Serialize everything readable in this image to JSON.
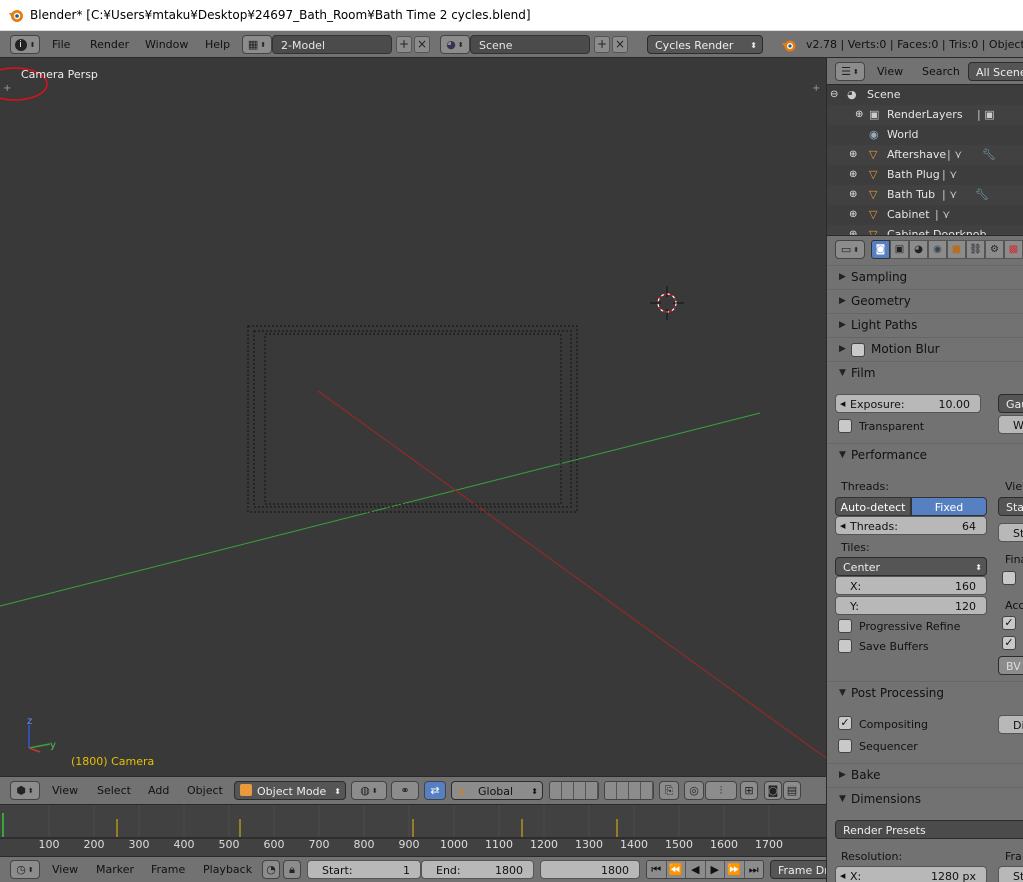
{
  "window_title": "Blender* [C:¥Users¥mtaku¥Desktop¥24697_Bath_Room¥Bath Time 2 cycles.blend]",
  "info_header": {
    "menus": [
      "File",
      "Render",
      "Window",
      "Help"
    ],
    "screen_layout": "2-Model",
    "scene": "Scene",
    "render_engine": "Cycles Render",
    "stats": "v2.78 | Verts:0 | Faces:0 | Tris:0 | Objects:0/"
  },
  "viewport": {
    "view_label": "Camera Persp",
    "object_label": "(1800) Camera"
  },
  "viewport_header": {
    "menus": [
      "View",
      "Select",
      "Add",
      "Object"
    ],
    "mode": "Object Mode",
    "orientation": "Global"
  },
  "timeline": {
    "ticks": [
      "100",
      "200",
      "300",
      "400",
      "500",
      "600",
      "700",
      "800",
      "900",
      "1000",
      "1100",
      "1200",
      "1300",
      "1400",
      "1500",
      "1600",
      "1700"
    ],
    "menus": [
      "View",
      "Marker",
      "Frame",
      "Playback"
    ],
    "start_label": "Start:",
    "start_value": "1",
    "end_label": "End:",
    "end_value": "1800",
    "current_frame": "1800",
    "frame_dropped": "Frame Dr"
  },
  "outliner": {
    "header_menus": [
      "View",
      "Search"
    ],
    "display_mode": "All Scene",
    "items": [
      {
        "label": "Scene"
      },
      {
        "label": "RenderLayers"
      },
      {
        "label": "World"
      },
      {
        "label": "Aftershave"
      },
      {
        "label": "Bath Plug"
      },
      {
        "label": "Bath Tub"
      },
      {
        "label": "Cabinet"
      },
      {
        "label": "Cabinet Doorknob"
      }
    ]
  },
  "properties": {
    "panels": {
      "sampling": "Sampling",
      "geometry": "Geometry",
      "light_paths": "Light Paths",
      "motion_blur": "Motion Blur",
      "film": "Film",
      "performance": "Performance",
      "post_processing": "Post Processing",
      "bake": "Bake",
      "dimensions": "Dimensions"
    },
    "film": {
      "exposure_label": "Exposure:",
      "exposure_value": "10.00",
      "transparent": "Transparent",
      "filter": "Gau",
      "width": "W"
    },
    "performance": {
      "threads_label": "Threads:",
      "auto_detect": "Auto-detect",
      "fixed": "Fixed",
      "threads_field": "Threads:",
      "threads_value": "64",
      "tiles_label": "Tiles:",
      "tile_order": "Center",
      "x_label": "X:",
      "x_value": "160",
      "y_label": "Y:",
      "y_value": "120",
      "progressive_refine": "Progressive Refine",
      "save_buffers": "Save Buffers",
      "viewport_label": "View",
      "stat": "Stat",
      "st": "St",
      "final": "Fina",
      "acc": "Acc",
      "bv": "BV"
    },
    "post_processing": {
      "compositing": "Compositing",
      "sequencer": "Sequencer",
      "dither": "Di"
    },
    "dimensions": {
      "render_presets": "Render Presets",
      "resolution_label": "Resolution:",
      "res_x_label": "X:",
      "res_x_value": "1280 px",
      "frame_label": "Fra",
      "st": "St"
    }
  },
  "colors": {
    "x_axis": "#8f2a2a",
    "y_axis": "#3aa33a",
    "selected_blue": "#5680c2",
    "highlight_yellow": "#e6c000",
    "annotation_red": "#e0101a"
  }
}
